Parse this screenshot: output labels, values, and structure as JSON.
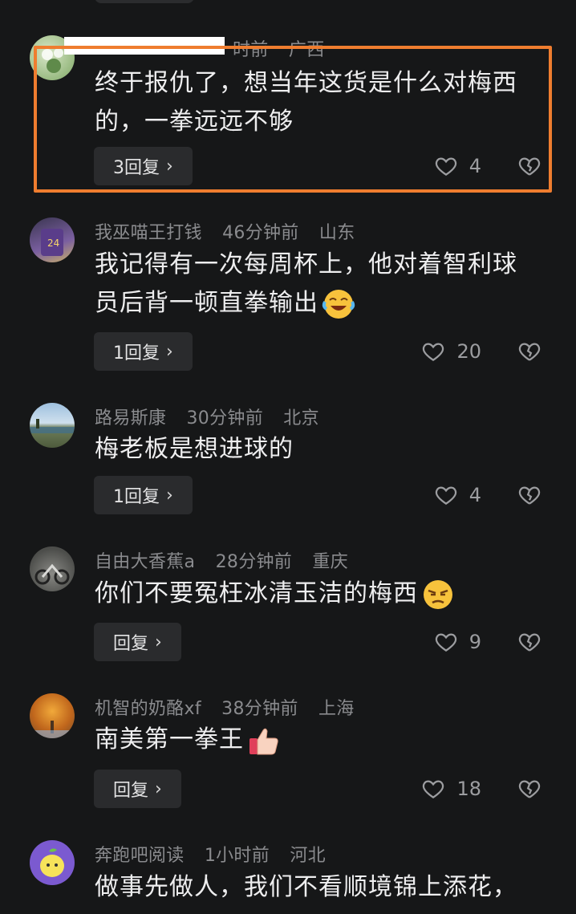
{
  "comments": [
    {
      "author": "",
      "time": "时前",
      "location": "广西",
      "text": "终于报仇了，想当年这货是什么对梅西的，一拳远远不够",
      "reply_label": "3回复",
      "likes": "4",
      "highlighted": true
    },
    {
      "author": "我巫喵王打钱",
      "time": "46分钟前",
      "location": "山东",
      "text": "我记得有一次每周杯上，他对着智利球员后背一顿直拳输出",
      "reply_label": "1回复",
      "likes": "20",
      "emoji": "laughing-crying-emoji"
    },
    {
      "author": "路易斯康",
      "time": "30分钟前",
      "location": "北京",
      "text": "梅老板是想进球的",
      "reply_label": "1回复",
      "likes": "4"
    },
    {
      "author": "自由大香蕉a",
      "time": "28分钟前",
      "location": "重庆",
      "text": "你们不要冤枉冰清玉洁的梅西",
      "reply_label": "回复",
      "likes": "9",
      "emoji": "annoyed-face-emoji"
    },
    {
      "author": "机智的奶酪xf",
      "time": "38分钟前",
      "location": "上海",
      "text": "南美第一拳王",
      "reply_label": "回复",
      "likes": "18",
      "emoji": "thumbs-up-emoji"
    },
    {
      "author": "奔跑吧阅读",
      "time": "1小时前",
      "location": "河北",
      "text": "做事先做人，我们不看顺境锦上添花，"
    }
  ],
  "colors": {
    "background": "#161718",
    "highlight_border": "#ef7d2f",
    "meta_text": "#8a8b8e",
    "button_bg": "#2a2b2d"
  }
}
